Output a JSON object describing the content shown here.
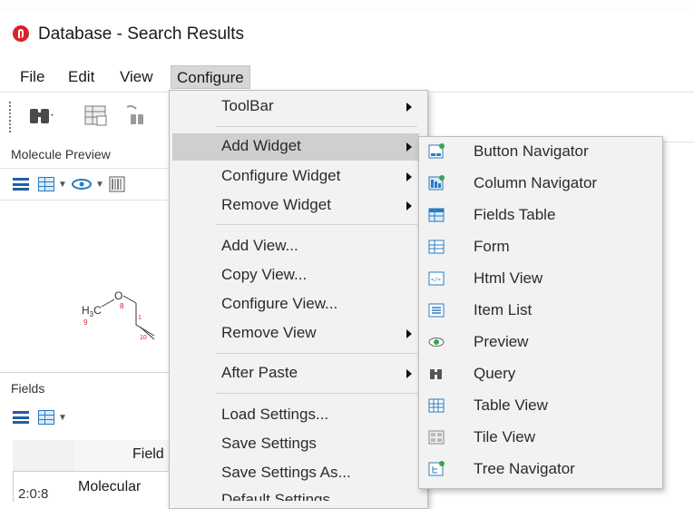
{
  "window": {
    "title": "Database - Search Results"
  },
  "menubar": {
    "items": [
      "File",
      "Edit",
      "View",
      "Configure"
    ]
  },
  "molecule_preview": {
    "title": "Molecule Preview",
    "atom_label": "H3C",
    "atom_label_main": "H",
    "atom_label_sub": "3",
    "atom_label_end": "C",
    "oxygen": "O",
    "index_9": "9",
    "index_8": "8",
    "index_10": "10",
    "index_1": "1"
  },
  "fields_panel": {
    "title": "Fields",
    "column_header": "Field",
    "row_number": "2:0:8",
    "row_value": "Molecular"
  },
  "configure_menu": {
    "items": [
      {
        "label": "ToolBar",
        "submenu": true
      },
      {
        "label": "Add Widget",
        "submenu": true,
        "highlighted": true
      },
      {
        "label": "Configure Widget",
        "submenu": true
      },
      {
        "label": "Remove Widget",
        "submenu": true
      },
      {
        "label": "Add View...",
        "submenu": false
      },
      {
        "label": "Copy View...",
        "submenu": false
      },
      {
        "label": "Configure View...",
        "submenu": false
      },
      {
        "label": "Remove View",
        "submenu": true
      },
      {
        "label": "After Paste",
        "submenu": true
      },
      {
        "label": "Load Settings...",
        "submenu": false
      },
      {
        "label": "Save Settings",
        "submenu": false
      },
      {
        "label": "Save Settings As...",
        "submenu": false
      },
      {
        "label": "Default Settings",
        "submenu": false
      }
    ]
  },
  "add_widget_submenu": {
    "items": [
      {
        "label": "Button Navigator",
        "icon": "button-navigator-icon"
      },
      {
        "label": "Column Navigator",
        "icon": "column-navigator-icon"
      },
      {
        "label": "Fields Table",
        "icon": "fields-table-icon"
      },
      {
        "label": "Form",
        "icon": "form-icon"
      },
      {
        "label": "Html View",
        "icon": "html-view-icon"
      },
      {
        "label": "Item List",
        "icon": "item-list-icon"
      },
      {
        "label": "Preview",
        "icon": "preview-eye-icon"
      },
      {
        "label": "Query",
        "icon": "query-binoculars-icon"
      },
      {
        "label": "Table View",
        "icon": "table-view-icon"
      },
      {
        "label": "Tile View",
        "icon": "tile-view-icon"
      },
      {
        "label": "Tree Navigator",
        "icon": "tree-navigator-icon"
      }
    ]
  },
  "colors": {
    "accent_blue": "#2a7bc0",
    "app_icon_red": "#d4252f",
    "menu_highlight": "#cfcfcf",
    "menu_bg": "#f2f2f2"
  }
}
